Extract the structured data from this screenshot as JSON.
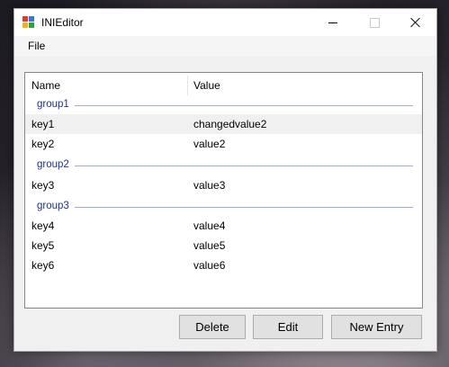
{
  "window": {
    "title": "INIEditor"
  },
  "menu": {
    "items": [
      "File"
    ]
  },
  "listview": {
    "columns": [
      "Name",
      "Value"
    ],
    "groups": [
      {
        "name": "group1",
        "rows": [
          {
            "key": "key1",
            "value": "changedvalue2",
            "selected": true
          },
          {
            "key": "key2",
            "value": "value2",
            "selected": false
          }
        ]
      },
      {
        "name": "group2",
        "rows": [
          {
            "key": "key3",
            "value": "value3",
            "selected": false
          }
        ]
      },
      {
        "name": "group3",
        "rows": [
          {
            "key": "key4",
            "value": "value4",
            "selected": false
          },
          {
            "key": "key5",
            "value": "value5",
            "selected": false
          },
          {
            "key": "key6",
            "value": "value6",
            "selected": false
          }
        ]
      }
    ]
  },
  "buttons": {
    "delete": "Delete",
    "edit": "Edit",
    "new_entry": "New Entry"
  },
  "colors": {
    "group_header_text": "#1e3287",
    "selection_background": "#f0f0f0"
  },
  "icons": {
    "app": "app-icon",
    "minimize": "minimize-icon",
    "maximize": "maximize-icon",
    "close": "close-icon"
  }
}
